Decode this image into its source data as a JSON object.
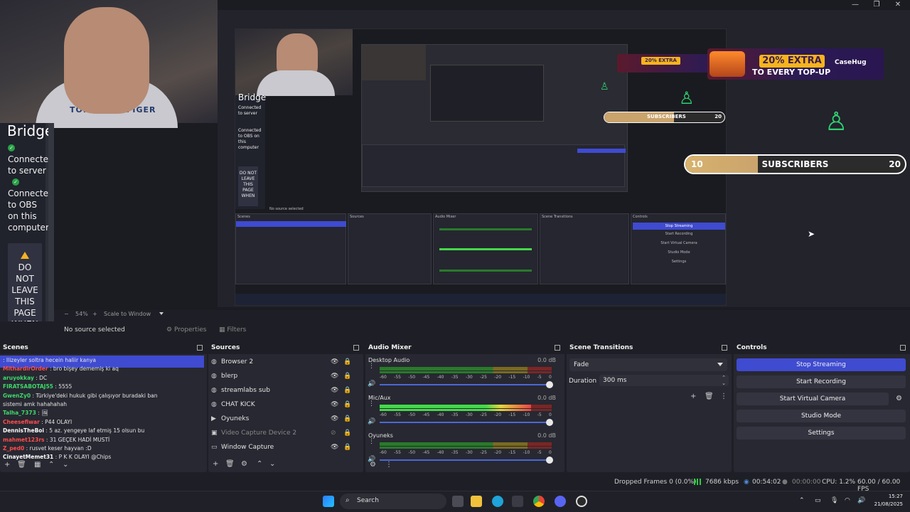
{
  "window": {
    "minimize": "—",
    "maximize": "❐",
    "close": "✕"
  },
  "preview": {
    "webcam_shirt_text": "TOMMY HILFIGER",
    "bridge": {
      "title": "Bridge",
      "status1": "Connected to server",
      "status2": "Connected to OBS on this computer",
      "warning": "DO NOT LEAVE THIS PAGE WHEN"
    },
    "nested": {
      "bridge_title": "Bridge",
      "status1": "Connected to server",
      "status2": "Connected to OBS on this computer",
      "warning": "DO NOT LEAVE THIS PAGE WHEN",
      "no_source": "No source selected",
      "docks": [
        "Scenes",
        "Sources",
        "Audio Mixer",
        "Scene Transitions",
        "Controls"
      ],
      "controls": [
        "Stop Streaming",
        "Start Recording",
        "Start Virtual Camera",
        "Studio Mode",
        "Settings"
      ]
    },
    "banner": {
      "highlight": "20% EXTRA",
      "subtitle": "TO EVERY TOP-UP",
      "logo": "CaseHug"
    },
    "subscribers": {
      "min": "10",
      "label": "SUBSCRIBERS",
      "max": "20",
      "progress": 0.33
    },
    "subscribers_small": {
      "label": "SUBSCRIBERS",
      "max": "20",
      "progress": 0.58
    },
    "footer": {
      "zoom_minus": "−",
      "zoom": "54%",
      "zoom_plus": "+",
      "scale_mode": "Scale to Window"
    }
  },
  "source_toolbar": {
    "no_source": "No source selected",
    "properties": "Properties",
    "filters": "Filters"
  },
  "scenes": {
    "title": "Scenes",
    "chat": [
      {
        "name": "",
        "text": ": Ilizeyler soltra hecein haliir kanya",
        "color": "#ffffff"
      },
      {
        "name": "MithardirOrder",
        "text": " : bro bişey dememiş ki aq",
        "color": "#ff4d4d"
      },
      {
        "name": "aruyokkay",
        "text": " : DC",
        "color": "#3fd86a"
      },
      {
        "name": "FIRATSABOTAJ55",
        "text": " : 5555",
        "color": "#3fd86a"
      },
      {
        "name": "GwenZy0",
        "text": " : Türkiye'deki hukuk gibi çalışıyor buradaki ban",
        "color": "#3fd86a"
      },
      {
        "name": "",
        "text": "sistemi amk hahahahah",
        "color": "#ffffff"
      },
      {
        "name": "Talha_7373",
        "text": " : 🖼",
        "color": "#3fd86a"
      },
      {
        "name": "Cheesefiwar",
        "text": " : P44 OLAYI",
        "color": "#ff4d4d"
      },
      {
        "name": "DennisTheBoi",
        "text": " : 5 az. yengeye laf etmiş 15 olsun bu",
        "color": "#ffffff"
      },
      {
        "name": "mahmet123rs",
        "text": " : 31 GEÇEK HADİ MUSTİ",
        "color": "#ff4d4d"
      },
      {
        "name": "Z_ped0",
        "text": " : rusvet keser hayvan :D",
        "color": "#ff4d4d"
      },
      {
        "name": "CinayetMemet31",
        "text": " : P K K OLAYI @Chips",
        "color": "#ffffff"
      }
    ]
  },
  "sources": {
    "title": "Sources",
    "items": [
      {
        "name": "Browser 2",
        "icon": "globe-icon",
        "visible": true
      },
      {
        "name": "blerp",
        "icon": "globe-icon",
        "visible": true
      },
      {
        "name": "streamlabs sub",
        "icon": "globe-icon",
        "visible": true
      },
      {
        "name": "CHAT KICK",
        "icon": "globe-icon",
        "visible": true
      },
      {
        "name": "Oyuneks",
        "icon": "play-icon",
        "visible": true
      },
      {
        "name": "Video Capture Device 2",
        "icon": "camera-icon",
        "visible": false
      },
      {
        "name": "Window Capture",
        "icon": "window-icon",
        "visible": true
      }
    ]
  },
  "mixer": {
    "title": "Audio Mixer",
    "ticks": [
      "-60",
      "-55",
      "-50",
      "-45",
      "-40",
      "-35",
      "-30",
      "-25",
      "-20",
      "-15",
      "-10",
      "-5",
      "0"
    ],
    "channels": [
      {
        "name": "Desktop Audio",
        "db": "0.0 dB",
        "level": 0.0
      },
      {
        "name": "Mic/Aux",
        "db": "0.0 dB",
        "level": 0.88
      },
      {
        "name": "Oyuneks",
        "db": "0.0 dB",
        "level": 0.0
      }
    ]
  },
  "transitions": {
    "title": "Scene Transitions",
    "selected": "Fade",
    "duration_label": "Duration",
    "duration_value": "300 ms"
  },
  "controls": {
    "title": "Controls",
    "stop_streaming": "Stop Streaming",
    "start_recording": "Start Recording",
    "start_virtual_camera": "Start Virtual Camera",
    "studio_mode": "Studio Mode",
    "settings": "Settings"
  },
  "status": {
    "dropped": "Dropped Frames 0 (0.0%)",
    "kbps": "7686 kbps",
    "stream_time": "00:54:02",
    "rec_time": "00:00:00",
    "cpu": "CPU: 1.2%",
    "fps": "60.00 / 60.00 FPS"
  },
  "taskbar": {
    "search": "Search",
    "time": "15:27",
    "date": "21/08/2025"
  }
}
